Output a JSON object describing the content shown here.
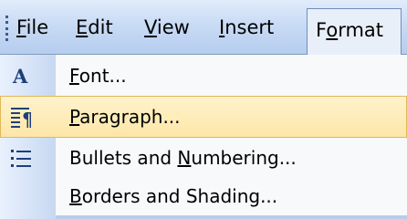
{
  "menubar": {
    "items": [
      {
        "pre": "",
        "u": "F",
        "post": "ile"
      },
      {
        "pre": "",
        "u": "E",
        "post": "dit"
      },
      {
        "pre": "",
        "u": "V",
        "post": "iew"
      },
      {
        "pre": "",
        "u": "I",
        "post": "nsert"
      },
      {
        "pre": "F",
        "u": "o",
        "post": "rmat"
      }
    ]
  },
  "dropdown": {
    "items": [
      {
        "pre": "",
        "u": "F",
        "post": "ont...",
        "icon": "font-icon"
      },
      {
        "pre": "",
        "u": "P",
        "post": "aragraph...",
        "icon": "paragraph-icon"
      },
      {
        "pre": "Bullets and ",
        "u": "N",
        "post": "umbering...",
        "icon": "bullets-icon"
      },
      {
        "pre": "",
        "u": "B",
        "post": "orders and Shading...",
        "icon": ""
      }
    ]
  },
  "colors": {
    "highlight": "#fde6a8",
    "highlight_border": "#e0b85a",
    "menubar": "#c9dbf5",
    "icon_column": "#c7d8f2"
  }
}
